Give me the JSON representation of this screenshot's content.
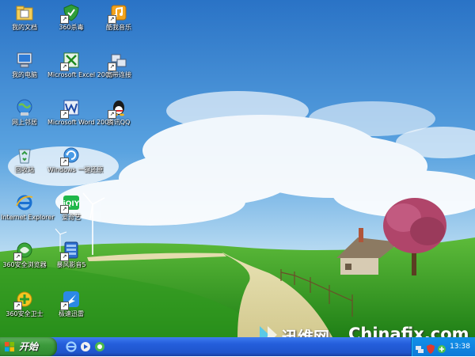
{
  "desktop": {
    "icons": [
      {
        "label": "我的文档",
        "icon": "my-documents-icon"
      },
      {
        "label": "360杀毒",
        "icon": "360-antivirus-icon"
      },
      {
        "label": "酷我音乐",
        "icon": "kuwo-music-icon"
      },
      {
        "label": "我的电脑",
        "icon": "my-computer-icon"
      },
      {
        "label": "Microsoft Excel 2003",
        "icon": "excel-icon"
      },
      {
        "label": "宽带连接",
        "icon": "broadband-connection-icon"
      },
      {
        "label": "网上邻居",
        "icon": "network-places-icon"
      },
      {
        "label": "Microsoft Word 2003",
        "icon": "word-icon"
      },
      {
        "label": "腾讯QQ",
        "icon": "qq-icon"
      },
      {
        "label": "回收站",
        "icon": "recycle-bin-icon"
      },
      {
        "label": "Windows 一键还原",
        "icon": "windows-restore-icon"
      },
      {
        "label": "Internet Explorer",
        "icon": "internet-explorer-icon"
      },
      {
        "label": "爱奇艺",
        "icon": "iqiyi-icon"
      },
      {
        "label": "360安全浏览器",
        "icon": "360-browser-icon"
      },
      {
        "label": "暴风影音5",
        "icon": "baofeng-player-icon"
      },
      {
        "label": "360安全卫士",
        "icon": "360-security-guard-icon"
      },
      {
        "label": "极速迅雷",
        "icon": "xunlei-icon"
      }
    ]
  },
  "taskbar": {
    "start_label": "开始",
    "quick_launch": [
      "internet-explorer-icon",
      "media-player-icon",
      "show-desktop-icon"
    ],
    "tray_icons": [
      "network-icon",
      "security-shield-icon",
      "360-tray-icon"
    ],
    "clock": "13:38"
  },
  "watermark": {
    "brand": "迅维网",
    "site": "Chinafix.com"
  },
  "colors": {
    "taskbar": "#245edb",
    "start_button": "#3c9a3c",
    "tray": "#0c7ad8",
    "sky": "#3a8fd8",
    "grass": "#3aa52a"
  }
}
